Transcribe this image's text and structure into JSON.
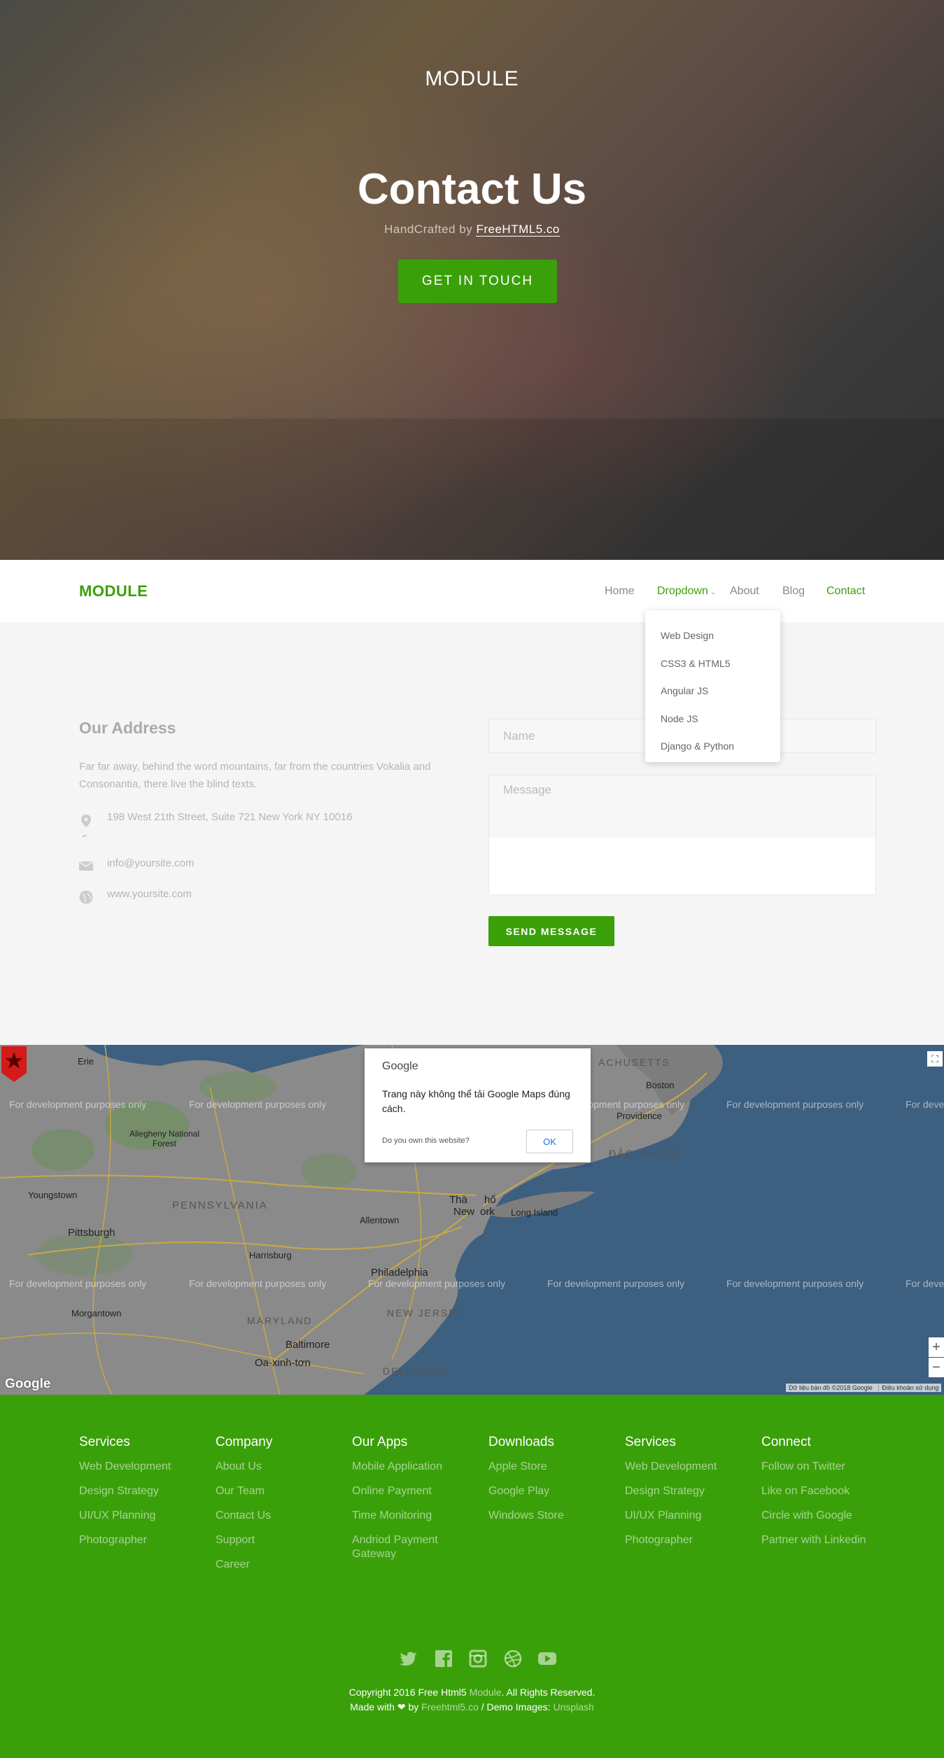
{
  "hero": {
    "logo": "MODULE",
    "title": "Contact Us",
    "sub_prefix": "HandCrafted by",
    "sub_link": "FreeHTML5.co",
    "cta": "GET IN TOUCH"
  },
  "nav": {
    "logo": "MODULE",
    "items": [
      {
        "label": "Home"
      },
      {
        "label": "Dropdown"
      },
      {
        "label": "About"
      },
      {
        "label": "Blog"
      },
      {
        "label": "Contact"
      }
    ],
    "dropdown": [
      "Web Design",
      "CSS3 & HTML5",
      "Angular JS",
      "Node JS",
      "Django & Python"
    ]
  },
  "contact": {
    "title": "Our Address",
    "text": "Far far away, behind the word mountains, far from the countries Vokalia and Consonantia, there live the blind texts.",
    "address": "198 West 21th Street, Suite 721 New York NY 10016",
    "email": "info@yoursite.com",
    "website": "www.yoursite.com",
    "name_placeholder": "Name",
    "message_placeholder": "Message",
    "send": "SEND MESSAGE"
  },
  "map": {
    "dev_text": "For development purposes only",
    "dialog_logo": "Google",
    "dialog_message": "Trang này không thể tải Google Maps đúng cách.",
    "dialog_own": "Do you own this website?",
    "dialog_ok": "OK",
    "google": "Google",
    "map_data": "Dữ liệu bản đồ ©2018 Google",
    "terms": "Điều khoản sử dụng",
    "places": {
      "boston": "Boston",
      "providence": "Providence",
      "pittsburgh": "Pittsburgh",
      "philadelphia": "Philadelphia",
      "baltimore": "Baltimore",
      "washington": "Oa-xinh-tơn",
      "allentown": "Allentown",
      "harrisburg": "Harrisburg",
      "youngstown": "Youngstown",
      "erie": "Erie",
      "morgantown": "Morgantown",
      "allegheny": "Allegheny National Forest",
      "long_island": "Long Island",
      "ny_a": "Thà",
      "ny_b": "New",
      "ny_c": "ork",
      "ny_d": "hố",
      "pennsylvania": "PENNSYLVANIA",
      "new_jersey": "NEW JERSEY",
      "maryland": "MARYLAND",
      "delaware": "DELAWARE",
      "rhode": "ĐẢO RHODE",
      "massachusetts": "ACHUSETTS"
    }
  },
  "footer": {
    "columns": [
      {
        "title": "Services",
        "links": [
          "Web Development",
          "Design Strategy",
          "UI/UX Planning",
          "Photographer"
        ]
      },
      {
        "title": "Company",
        "links": [
          "About Us",
          "Our Team",
          "Contact Us",
          "Support",
          "Career"
        ]
      },
      {
        "title": "Our Apps",
        "links": [
          "Mobile Application",
          "Online Payment",
          "Time Monitoring",
          "Andriod Payment Gateway"
        ]
      },
      {
        "title": "Downloads",
        "links": [
          "Apple Store",
          "Google Play",
          "Windows Store"
        ]
      },
      {
        "title": "Services",
        "links": [
          "Web Development",
          "Design Strategy",
          "UI/UX Planning",
          "Photographer"
        ]
      },
      {
        "title": "Connect",
        "links": [
          "Follow on Twitter",
          "Like on Facebook",
          "Circle with Google",
          "Partner with Linkedin"
        ]
      }
    ],
    "copyright_a": "Copyright 2016 Free Html5",
    "copyright_b": "Module",
    "copyright_c": ". All Rights Reserved.",
    "made_a": "Made with",
    "made_heart": "❤",
    "made_b": "by",
    "made_link": "Freehtml5.co",
    "made_c": "/ Demo Images:",
    "made_link2": "Unsplash"
  },
  "colors": {
    "accent": "#3aa00a",
    "map_water": "#3d5f80",
    "pin": "#d51a1a"
  }
}
